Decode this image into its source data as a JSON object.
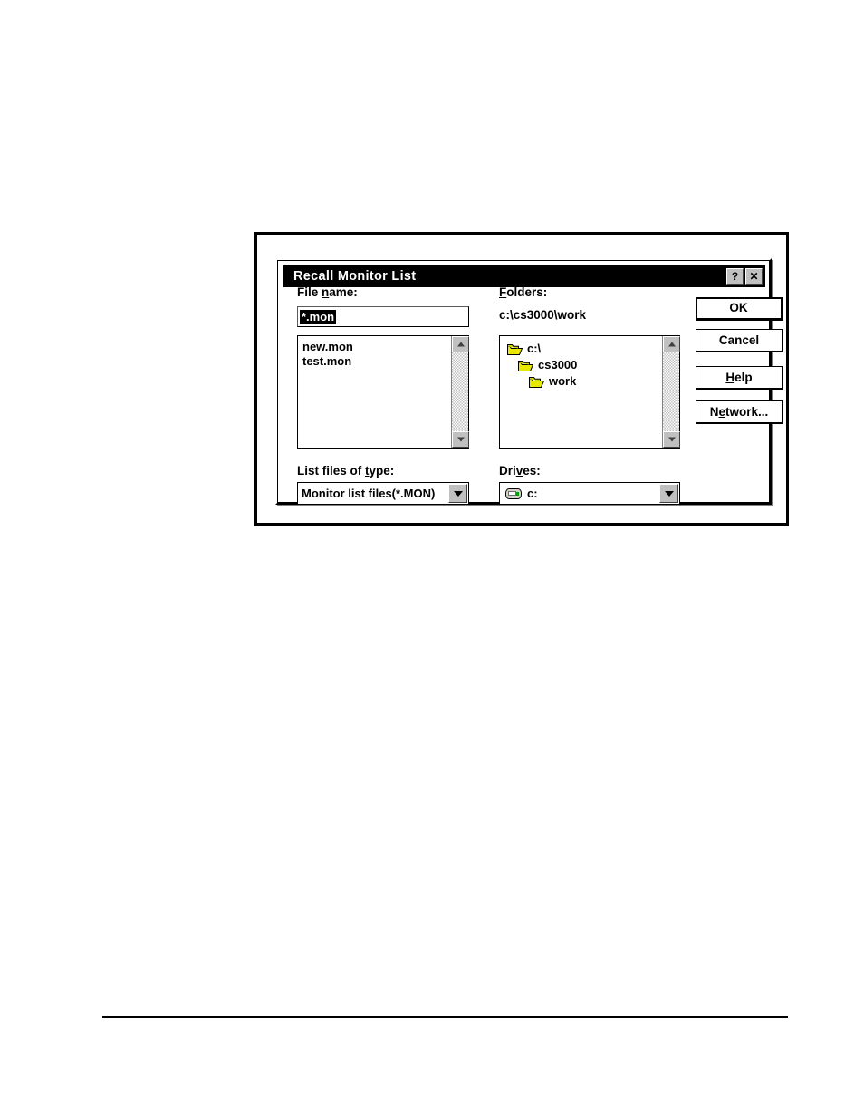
{
  "document": {
    "background_color": "#ffffff",
    "footer_rule": true
  },
  "dialog": {
    "title": "Recall Monitor List",
    "title_bar": {
      "background_color": "#000000",
      "text_color": "#ffffff",
      "help_button": "?",
      "close_button": "✕"
    },
    "file_name": {
      "label_pre": "File ",
      "label_accel": "n",
      "label_post": "ame:",
      "value": "*.mon",
      "placeholder": "",
      "selected": true
    },
    "file_list": {
      "items": [
        "new.mon",
        "test.mon"
      ],
      "scrollbar": {
        "up": "▲",
        "down": "▼"
      }
    },
    "list_files_of_type": {
      "label_pre": "List files of ",
      "label_accel": "t",
      "label_post": "ype:",
      "selected": "Monitor list files(*.MON)",
      "options": [
        "Monitor list files(*.MON)"
      ]
    },
    "folders": {
      "label_pre": "",
      "label_accel": "F",
      "label_post": "olders:",
      "current_path": "c:\\cs3000\\work",
      "tree": [
        {
          "name": "c:\\",
          "depth": 0,
          "icon": "folder-open-icon"
        },
        {
          "name": "cs3000",
          "depth": 1,
          "icon": "folder-open-icon"
        },
        {
          "name": "work",
          "depth": 2,
          "icon": "folder-open-icon"
        }
      ],
      "scrollbar": {
        "up": "▲",
        "down": "▼"
      }
    },
    "drives": {
      "label_pre": "Dri",
      "label_accel": "v",
      "label_post": "es:",
      "selected": "c:",
      "options": [
        "c:"
      ],
      "icon": "hard-drive-icon"
    },
    "buttons": {
      "ok": {
        "label": "OK",
        "default": true
      },
      "cancel": {
        "label": "Cancel"
      },
      "help": {
        "label_pre": "",
        "label_accel": "H",
        "label_post": "elp"
      },
      "network": {
        "label_pre": "N",
        "label_accel": "e",
        "label_post": "twork..."
      }
    }
  }
}
